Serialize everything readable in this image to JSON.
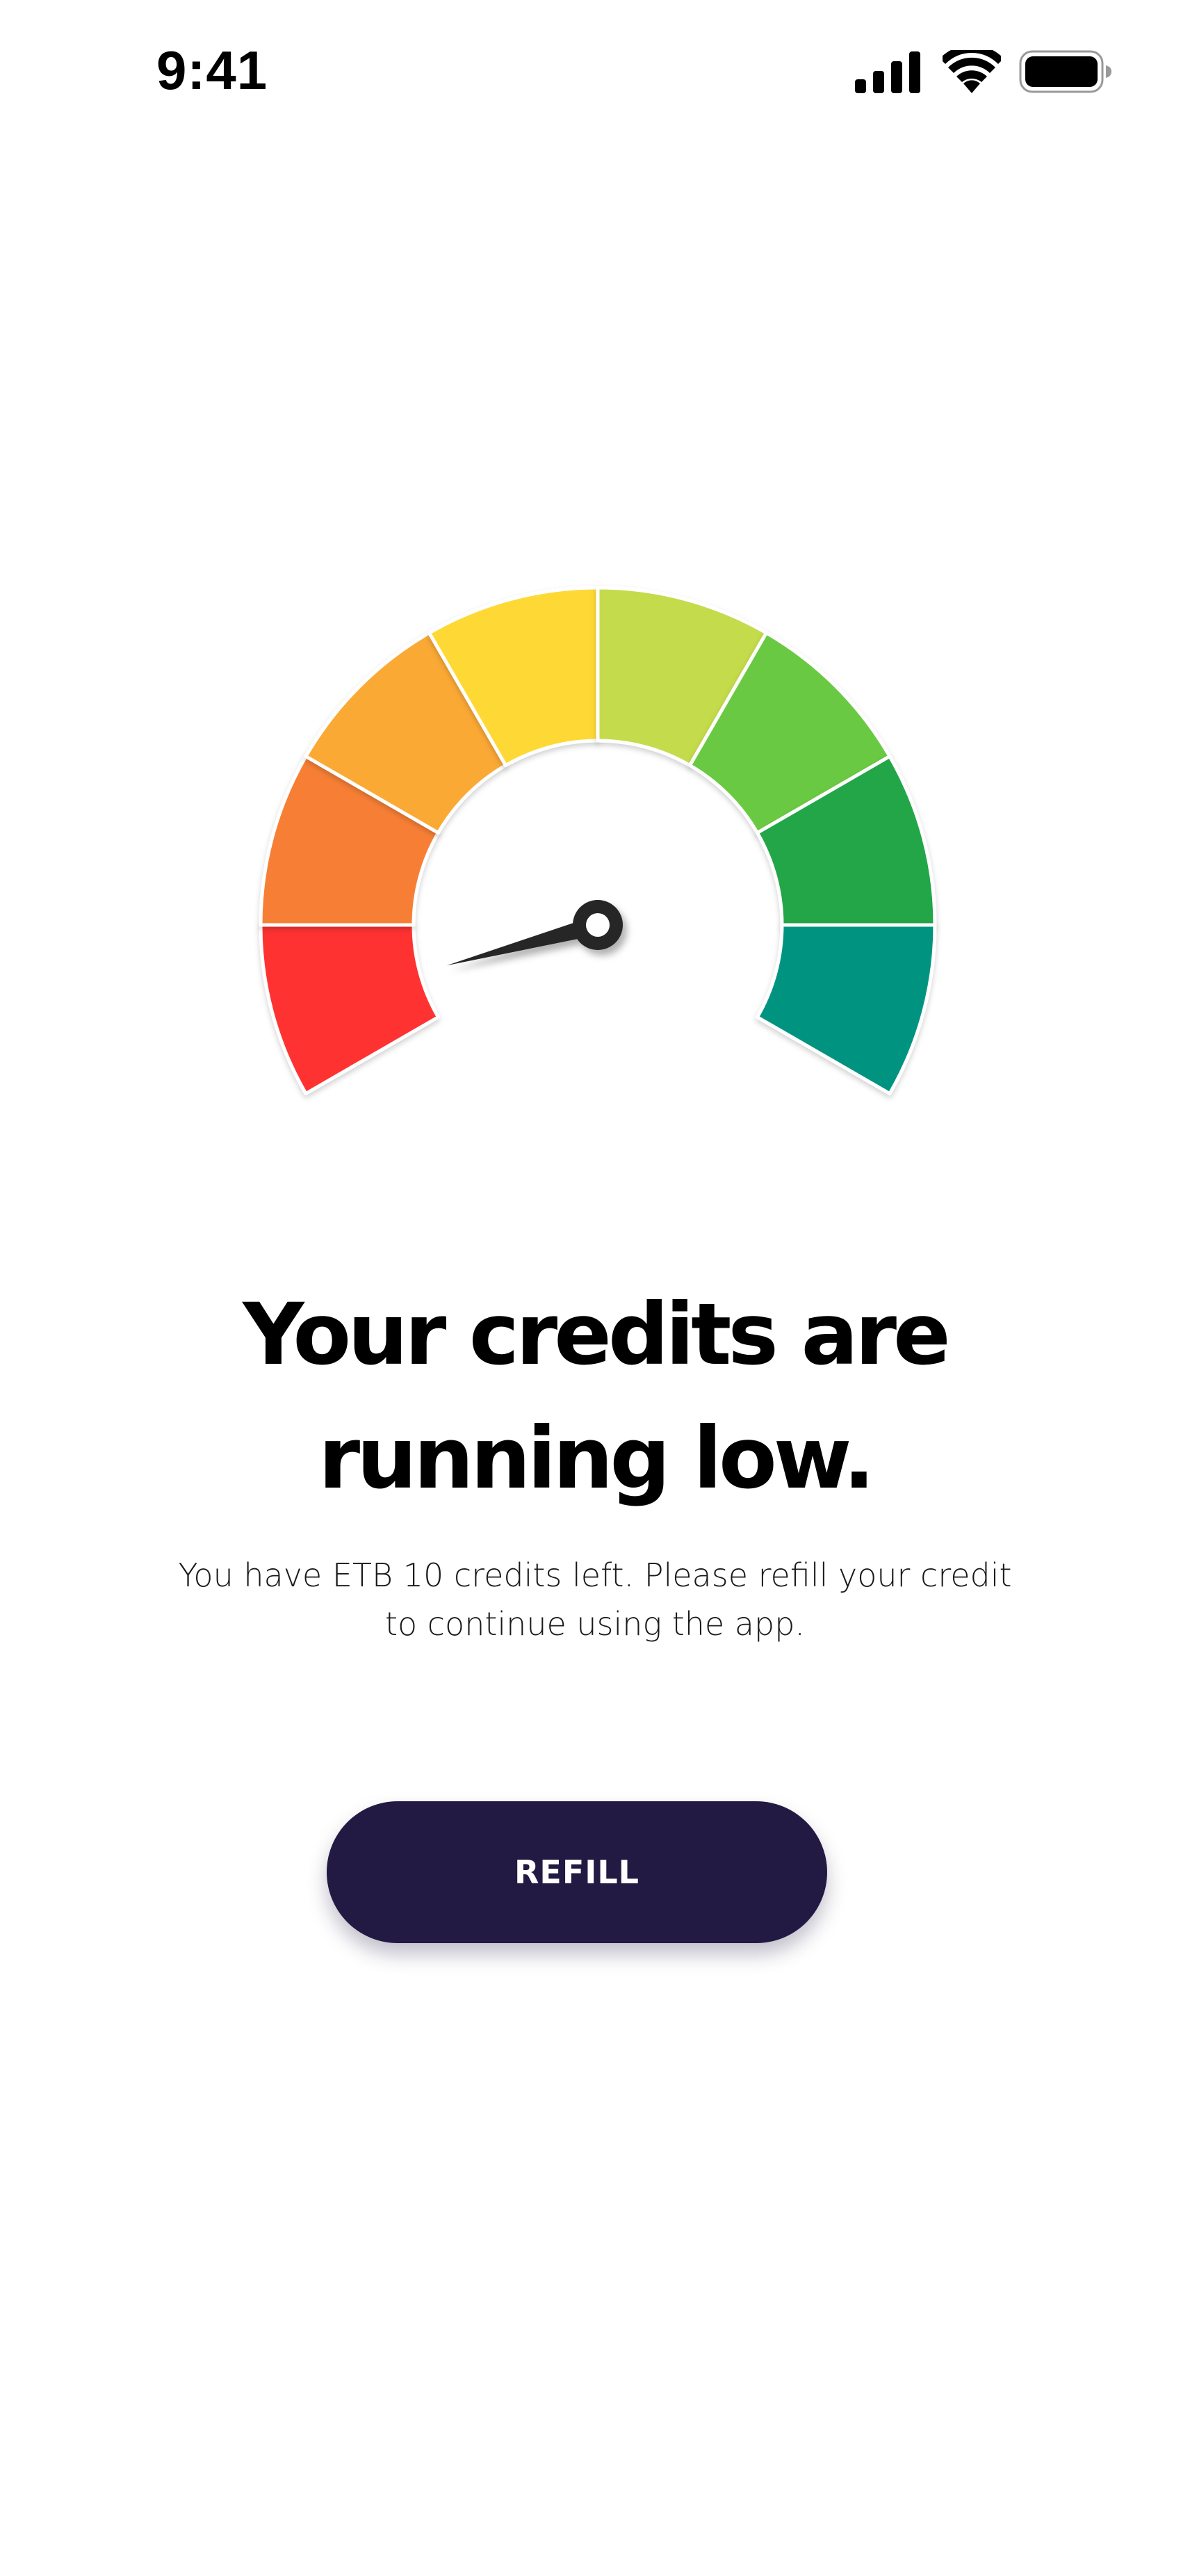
{
  "status_bar": {
    "time": "9:41",
    "icons": [
      "cellular-signal-icon",
      "wifi-icon",
      "battery-icon"
    ]
  },
  "gauge": {
    "level": 0.08,
    "needle_angle_deg": 195,
    "segment_colors": [
      "#ff3333",
      "#f77f36",
      "#fba935",
      "#fed936",
      "#c4db4c",
      "#6bc942",
      "#21a646",
      "#009480"
    ],
    "needle_color": "#262626"
  },
  "headline": {
    "line1": "Your credits are",
    "line2": "running low."
  },
  "message": {
    "line1": "You have ETB 10 credits left. Please refill your credit",
    "line2": "to continue using the app."
  },
  "refill_button": {
    "label": "REFILL",
    "background_color": "#221a42"
  }
}
